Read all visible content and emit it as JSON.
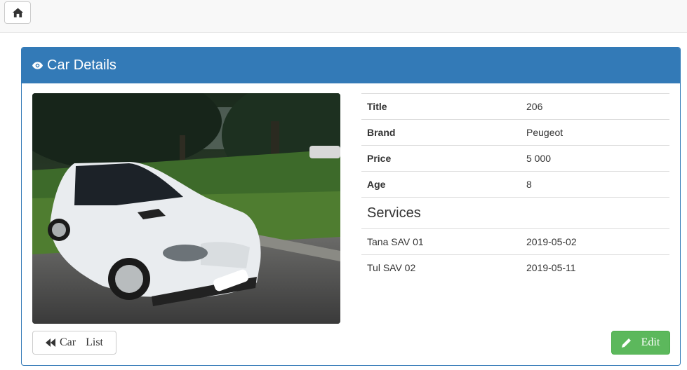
{
  "panel": {
    "title": "Car Details"
  },
  "details": [
    {
      "label": "Title",
      "value": "206"
    },
    {
      "label": "Brand",
      "value": "Peugeot"
    },
    {
      "label": "Price",
      "value": "5 000"
    },
    {
      "label": "Age",
      "value": "8"
    }
  ],
  "services": {
    "heading": "Services",
    "items": [
      {
        "name": "Tana SAV 01",
        "date": "2019-05-02"
      },
      {
        "name": "Tul SAV 02",
        "date": "2019-05-11"
      }
    ]
  },
  "buttons": {
    "car_list": "Car List",
    "edit": "Edit"
  },
  "colors": {
    "primary": "#337ab7",
    "success": "#5cb85c"
  },
  "icons": {
    "home": "home-icon",
    "eye": "eye-icon",
    "back": "fast-backward-icon",
    "edit": "pencil-icon"
  }
}
